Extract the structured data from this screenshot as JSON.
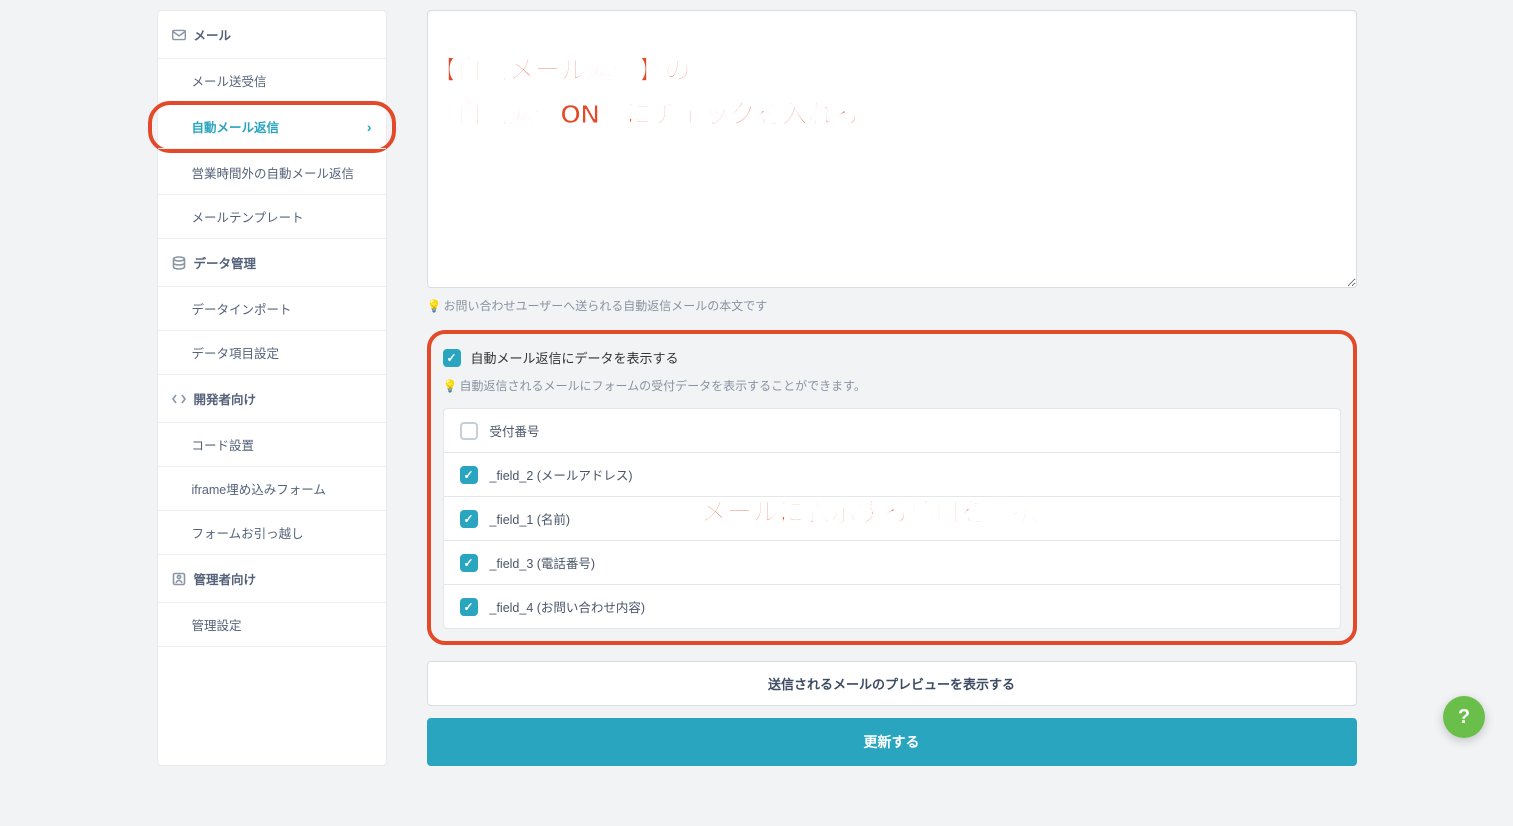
{
  "sidebar": {
    "sections": [
      {
        "key": "mail",
        "label": "メール",
        "items": [
          {
            "key": "sendrecv",
            "label": "メール送受信"
          },
          {
            "key": "autoreply",
            "label": "自動メール返信",
            "active": true
          },
          {
            "key": "afterhours",
            "label": "営業時間外の自動メール返信"
          },
          {
            "key": "templates",
            "label": "メールテンプレート"
          }
        ]
      },
      {
        "key": "data",
        "label": "データ管理",
        "items": [
          {
            "key": "import",
            "label": "データインポート"
          },
          {
            "key": "fields",
            "label": "データ項目設定"
          }
        ]
      },
      {
        "key": "dev",
        "label": "開発者向け",
        "items": [
          {
            "key": "code",
            "label": "コード設置"
          },
          {
            "key": "iframe",
            "label": "iframe埋め込みフォーム"
          },
          {
            "key": "migrate",
            "label": "フォームお引っ越し"
          }
        ]
      },
      {
        "key": "admin",
        "label": "管理者向け",
        "items": [
          {
            "key": "settings",
            "label": "管理設定"
          }
        ]
      }
    ]
  },
  "main": {
    "body_hint": "お問い合わせユーザーへ送られる自動返信メールの本文です",
    "show_data": {
      "label": "自動メール返信にデータを表示する",
      "hint": "自動返信されるメールにフォームの受付データを表示することができます。",
      "fields": [
        {
          "key": "receipt_no",
          "label": "受付番号",
          "checked": false
        },
        {
          "key": "field2",
          "label": "_field_2 (メールアドレス)",
          "checked": true
        },
        {
          "key": "field1",
          "label": "_field_1 (名前)",
          "checked": true
        },
        {
          "key": "field3",
          "label": "_field_3 (電話番号)",
          "checked": true
        },
        {
          "key": "field4",
          "label": "_field_4 (お問い合わせ内容)",
          "checked": true
        }
      ]
    },
    "preview_button": "送信されるメールのプレビューを表示する",
    "update_button": "更新する"
  },
  "annotations": {
    "top_line1": "【自動メール返信】の",
    "top_line2": "「自動返信ON」にチェックを入れる",
    "mid": "メールに表示する項目を選択"
  },
  "help": {
    "label": "?"
  }
}
